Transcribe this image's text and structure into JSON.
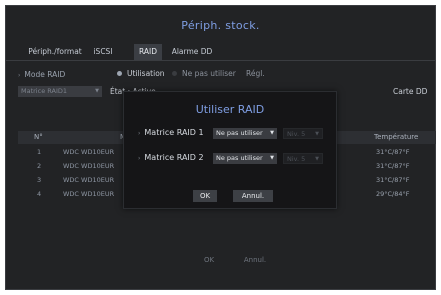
{
  "title": "Périph. stock.",
  "tabs": [
    {
      "label": "Périph./format",
      "active": false
    },
    {
      "label": "iSCSI",
      "active": false
    },
    {
      "label": "RAID",
      "active": true
    },
    {
      "label": "Alarme DD",
      "active": false
    }
  ],
  "mode": {
    "label": "Mode RAID",
    "option_use": "Utilisation",
    "option_no_use": "Ne pas utiliser",
    "selected": "Utilisation",
    "setting": "Régl."
  },
  "matrix": {
    "selected": "Matrice RAID1",
    "state_label": "État : Active",
    "card": "Carte DD"
  },
  "table": {
    "headers": {
      "no": "N°",
      "model": "M",
      "temp": "Température"
    },
    "rows": [
      {
        "no": "1",
        "model": "WDC WD10EUR",
        "temp": "31°C/87°F"
      },
      {
        "no": "2",
        "model": "WDC WD10EUR",
        "temp": "31°C/87°F"
      },
      {
        "no": "3",
        "model": "WDC WD10EUR",
        "temp": "31°C/87°F"
      },
      {
        "no": "4",
        "model": "WDC WD10EUR",
        "temp": "29°C/84°F"
      }
    ]
  },
  "footer": {
    "ok": "OK",
    "cancel": "Annul."
  },
  "dialog": {
    "title": "Utiliser RAID",
    "rows": [
      {
        "label": "Matrice RAID 1",
        "value": "Ne pas utiliser",
        "level": "Niv. 5"
      },
      {
        "label": "Matrice RAID 2",
        "value": "Ne pas utiliser",
        "level": "Niv. 5"
      }
    ],
    "ok": "OK",
    "cancel": "Annul."
  },
  "colors": {
    "accent": "#7f9ee3",
    "background": "#222325",
    "dialog": "#151517"
  }
}
